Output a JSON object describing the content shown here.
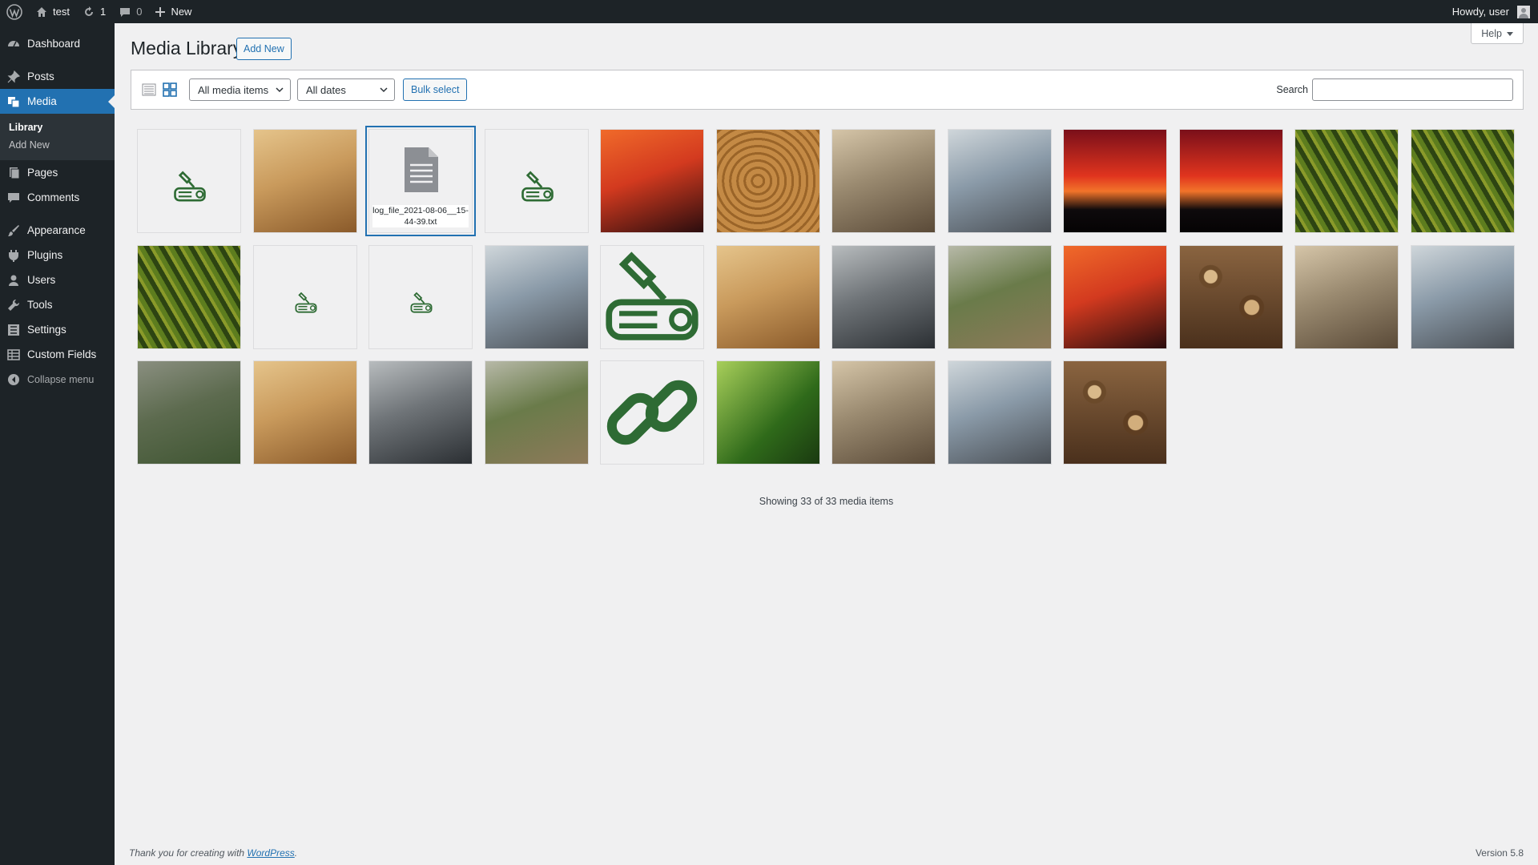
{
  "adminbar": {
    "site_name": "test",
    "updates_count": "1",
    "comments_count": "0",
    "new_label": "New",
    "howdy": "Howdy, user"
  },
  "sidebar": {
    "items": [
      {
        "label": "Dashboard",
        "icon": "dashboard-icon"
      },
      {
        "label": "Posts",
        "icon": "pin-icon"
      },
      {
        "label": "Media",
        "icon": "media-icon"
      },
      {
        "label": "Pages",
        "icon": "page-icon"
      },
      {
        "label": "Comments",
        "icon": "comment-icon"
      },
      {
        "label": "Appearance",
        "icon": "brush-icon"
      },
      {
        "label": "Plugins",
        "icon": "plug-icon"
      },
      {
        "label": "Users",
        "icon": "user-icon"
      },
      {
        "label": "Tools",
        "icon": "wrench-icon"
      },
      {
        "label": "Settings",
        "icon": "sliders-icon"
      },
      {
        "label": "Custom Fields",
        "icon": "table-icon"
      }
    ],
    "media_submenu": [
      "Library",
      "Add New"
    ],
    "collapse_label": "Collapse menu"
  },
  "page": {
    "title": "Media Library",
    "add_new": "Add New",
    "help": "Help"
  },
  "toolbar": {
    "type_filter": "All media items",
    "date_filter": "All dates",
    "bulk_select": "Bulk select",
    "search_label": "Search",
    "search_value": ""
  },
  "media_items": [
    {
      "kind": "logo",
      "label": "axe-log logo thumbnail"
    },
    {
      "kind": "photo",
      "label": "harvester in forest"
    },
    {
      "kind": "document",
      "label": "log_file_2021-08-06__15-44-39.txt",
      "selected": true
    },
    {
      "kind": "logo",
      "label": "axe-log logo thumbnail"
    },
    {
      "kind": "photo",
      "label": "harvester in forest"
    },
    {
      "kind": "photo",
      "label": "cut log end with tags"
    },
    {
      "kind": "photo",
      "label": "chainsaw chain"
    },
    {
      "kind": "photo",
      "label": "forest path"
    },
    {
      "kind": "photo",
      "label": "red sunset over forest"
    },
    {
      "kind": "photo",
      "label": "red sunset over forest"
    },
    {
      "kind": "photo",
      "label": "aerial conifer forest"
    },
    {
      "kind": "photo",
      "label": "aerial conifer forest"
    },
    {
      "kind": "photo",
      "label": "aerial conifer forest"
    },
    {
      "kind": "logo",
      "label": "small axe-log logo"
    },
    {
      "kind": "logo",
      "label": "small axe-log logo"
    },
    {
      "kind": "photo",
      "label": "stacked logs by road"
    },
    {
      "kind": "logo-large",
      "label": "large axe-log logo"
    },
    {
      "kind": "photo",
      "label": "winter log piles"
    },
    {
      "kind": "photo",
      "label": "aerial log yard"
    },
    {
      "kind": "photo",
      "label": "aerial sawmill yard"
    },
    {
      "kind": "photo",
      "label": "logging truck on road"
    },
    {
      "kind": "photo",
      "label": "stacked firewood"
    },
    {
      "kind": "photo",
      "label": "workers in autumn forest"
    },
    {
      "kind": "photo",
      "label": "pallets of bags"
    },
    {
      "kind": "photo",
      "label": "forwarder machine"
    },
    {
      "kind": "photo",
      "label": "log train car"
    },
    {
      "kind": "photo",
      "label": "forestry workers"
    },
    {
      "kind": "photo",
      "label": "cleared land with log pile"
    },
    {
      "kind": "link-icon",
      "label": "chain link icon"
    },
    {
      "kind": "photo",
      "label": "green leaves"
    },
    {
      "kind": "photo",
      "label": "harvester in forest"
    },
    {
      "kind": "photo",
      "label": "clear-cut forest"
    },
    {
      "kind": "photo",
      "label": "firewood ends"
    }
  ],
  "showing": "Showing 33 of 33 media items",
  "footer": {
    "thanks_prefix": "Thank you for creating with",
    "wp_link": "WordPress",
    "version": "Version 5.8"
  },
  "colors": {
    "admin_bg": "#1d2327",
    "accent": "#2271b1",
    "logo_green": "#2e6b34"
  }
}
